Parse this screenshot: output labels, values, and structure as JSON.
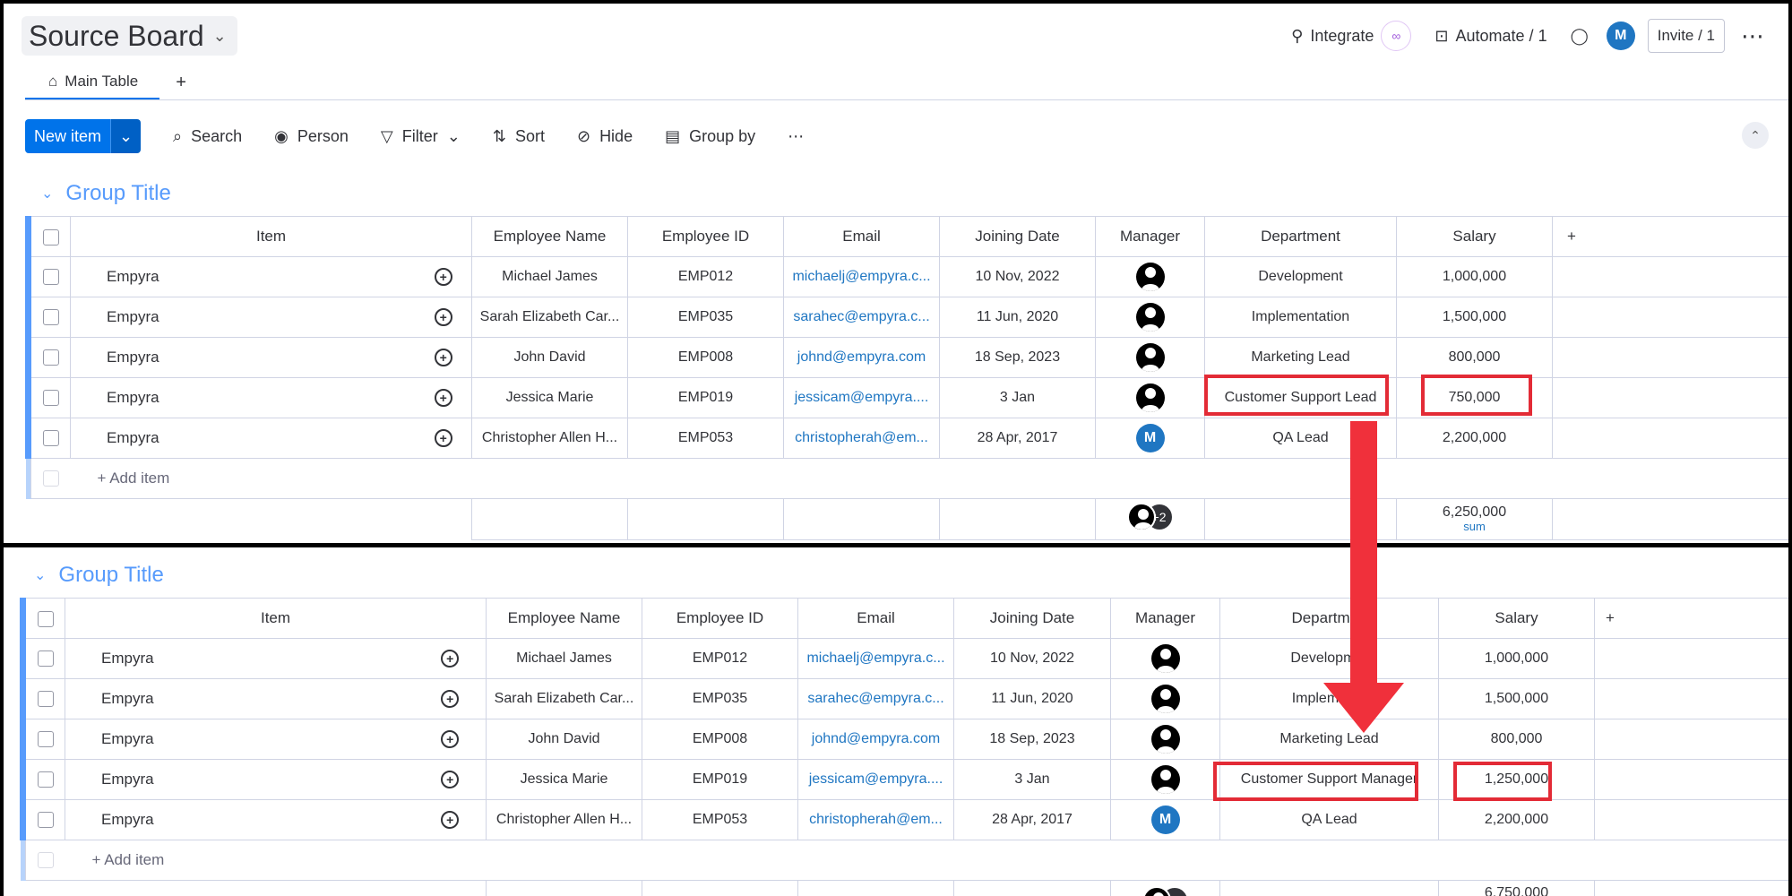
{
  "board": {
    "title": "Source Board",
    "tab_main": "Main Table",
    "tab_add": "+"
  },
  "top_actions": {
    "integrate": "Integrate",
    "automate": "Automate / 1",
    "avatar_initial": "M",
    "invite": "Invite / 1"
  },
  "toolbar": {
    "new_item": "New item",
    "search": "Search",
    "person": "Person",
    "filter": "Filter",
    "sort": "Sort",
    "hide": "Hide",
    "group_by": "Group by"
  },
  "columns": [
    "Item",
    "Employee Name",
    "Employee ID",
    "Email",
    "Joining Date",
    "Manager",
    "Department",
    "Salary"
  ],
  "top_group": {
    "title": "Group Title",
    "rows": [
      {
        "item": "Empyra",
        "name": "Michael James",
        "id": "EMP012",
        "email": "michaelj@empyra.c...",
        "date": "10 Nov, 2022",
        "manager": "person",
        "department": "Development",
        "salary": "1,000,000"
      },
      {
        "item": "Empyra",
        "name": "Sarah Elizabeth Car...",
        "id": "EMP035",
        "email": "sarahec@empyra.c...",
        "date": "11 Jun, 2020",
        "manager": "person",
        "department": "Implementation",
        "salary": "1,500,000"
      },
      {
        "item": "Empyra",
        "name": "John David",
        "id": "EMP008",
        "email": "johnd@empyra.com",
        "date": "18 Sep, 2023",
        "manager": "person",
        "department": "Marketing Lead",
        "salary": "800,000"
      },
      {
        "item": "Empyra",
        "name": "Jessica Marie",
        "id": "EMP019",
        "email": "jessicam@empyra....",
        "date": "3 Jan",
        "manager": "person",
        "department": "Customer Support Lead",
        "salary": "750,000"
      },
      {
        "item": "Empyra",
        "name": "Christopher Allen H...",
        "id": "EMP053",
        "email": "christopherah@em...",
        "date": "28 Apr, 2017",
        "manager": "M",
        "department": "QA Lead",
        "salary": "2,200,000"
      }
    ],
    "add_item": "+ Add item",
    "sum_value": "6,250,000",
    "sum_label": "sum",
    "manager_extra": "+2"
  },
  "bottom_group": {
    "title": "Group Title",
    "rows": [
      {
        "item": "Empyra",
        "name": "Michael James",
        "id": "EMP012",
        "email": "michaelj@empyra.c...",
        "date": "10 Nov, 2022",
        "manager": "person",
        "department": "Developmer",
        "salary": "1,000,000"
      },
      {
        "item": "Empyra",
        "name": "Sarah Elizabeth Car...",
        "id": "EMP035",
        "email": "sarahec@empyra.c...",
        "date": "11 Jun, 2020",
        "manager": "person",
        "department": "Implementa",
        "salary": "1,500,000"
      },
      {
        "item": "Empyra",
        "name": "John David",
        "id": "EMP008",
        "email": "johnd@empyra.com",
        "date": "18 Sep, 2023",
        "manager": "person",
        "department": "Marketing Lead",
        "salary": "800,000"
      },
      {
        "item": "Empyra",
        "name": "Jessica Marie",
        "id": "EMP019",
        "email": "jessicam@empyra....",
        "date": "3 Jan",
        "manager": "person",
        "department": "Customer Support Manager",
        "salary": "1,250,000"
      },
      {
        "item": "Empyra",
        "name": "Christopher Allen H...",
        "id": "EMP053",
        "email": "christopherah@em...",
        "date": "28 Apr, 2017",
        "manager": "M",
        "department": "QA Lead",
        "salary": "2,200,000"
      }
    ],
    "add_item": "+ Add item",
    "sum_value": "6,750,000",
    "bottom_department_header": "Departmen"
  },
  "colors": {
    "accent": "#0073ea",
    "group": "#579bfc",
    "highlight": "#e32b36",
    "arrow": "#f0303b"
  }
}
